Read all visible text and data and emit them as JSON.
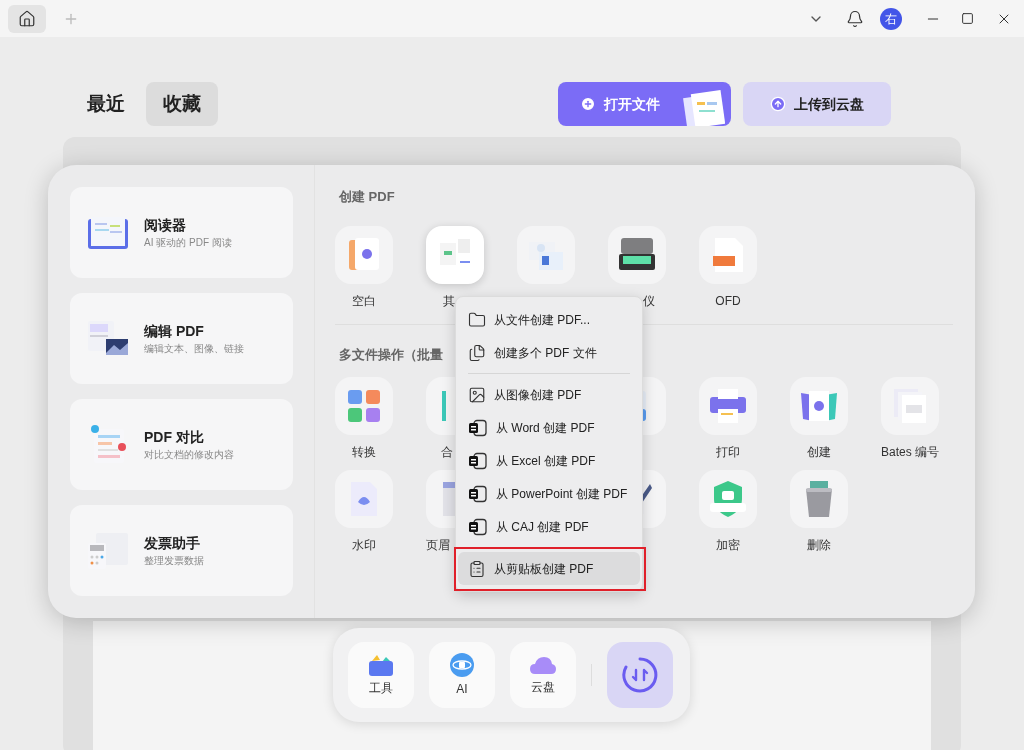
{
  "title_bar": {
    "avatar_initial": "右"
  },
  "tabs": [
    {
      "label": "最近",
      "selected": false
    },
    {
      "label": "收藏",
      "selected": true
    }
  ],
  "actions": [
    {
      "label": "打开文件",
      "kind": "primary"
    },
    {
      "label": "上传到云盘",
      "kind": "secondary"
    }
  ],
  "features": [
    {
      "title": "阅读器",
      "subtitle": "AI 驱动的 PDF 阅读"
    },
    {
      "title": "编辑 PDF",
      "subtitle": "编辑文本、图像、链接"
    },
    {
      "title": "PDF 对比",
      "subtitle": "对比文档的修改内容"
    },
    {
      "title": "发票助手",
      "subtitle": "整理发票数据"
    }
  ],
  "create_section": {
    "title": "创建 PDF",
    "tools": [
      {
        "label": "空白",
        "hovered": false
      },
      {
        "label": "其",
        "hovered": true
      },
      {
        "hovered": false
      },
      {
        "label": "仪",
        "hovered": false
      },
      {
        "label": "OFD",
        "hovered": false
      }
    ]
  },
  "batch_section": {
    "title": "多文件操作（批量",
    "rows": [
      {
        "left": [
          {
            "label": "转换",
            "hovered": false
          },
          {
            "label": "合",
            "hovered": false
          }
        ],
        "right": [
          {
            "hovered": false
          },
          {
            "label": "打印",
            "hovered": false
          },
          {
            "label": "创建",
            "hovered": false
          },
          {
            "label": "Bates 编号",
            "hovered": false
          }
        ]
      },
      {
        "left": [
          {
            "label": "水印",
            "hovered": false
          },
          {
            "label": "页眉",
            "hovered": false
          }
        ],
        "right": [
          {
            "hovered": false
          },
          {
            "label": "加密",
            "hovered": false
          },
          {
            "label": "删除",
            "hovered": false
          }
        ]
      }
    ]
  },
  "menu": {
    "groups": [
      [
        {
          "label": "从文件创建 PDF...",
          "selected": false,
          "outlined": false
        },
        {
          "label": "创建多个 PDF 文件",
          "selected": false,
          "outlined": false
        }
      ],
      [
        {
          "label": "从图像创建 PDF",
          "selected": false,
          "outlined": false
        },
        {
          "label": "从 Word 创建 PDF",
          "selected": false,
          "outlined": false
        },
        {
          "label": "从 Excel 创建 PDF",
          "selected": false,
          "outlined": false
        },
        {
          "label": "从 PowerPoint 创建 PDF",
          "selected": false,
          "outlined": false
        },
        {
          "label": "从 CAJ 创建 PDF",
          "selected": false,
          "outlined": false
        }
      ],
      [
        {
          "label": "从剪贴板创建 PDF",
          "selected": true,
          "outlined": true
        }
      ]
    ]
  },
  "dock": [
    {
      "label": "工具"
    },
    {
      "label": "AI"
    },
    {
      "label": "云盘"
    }
  ]
}
